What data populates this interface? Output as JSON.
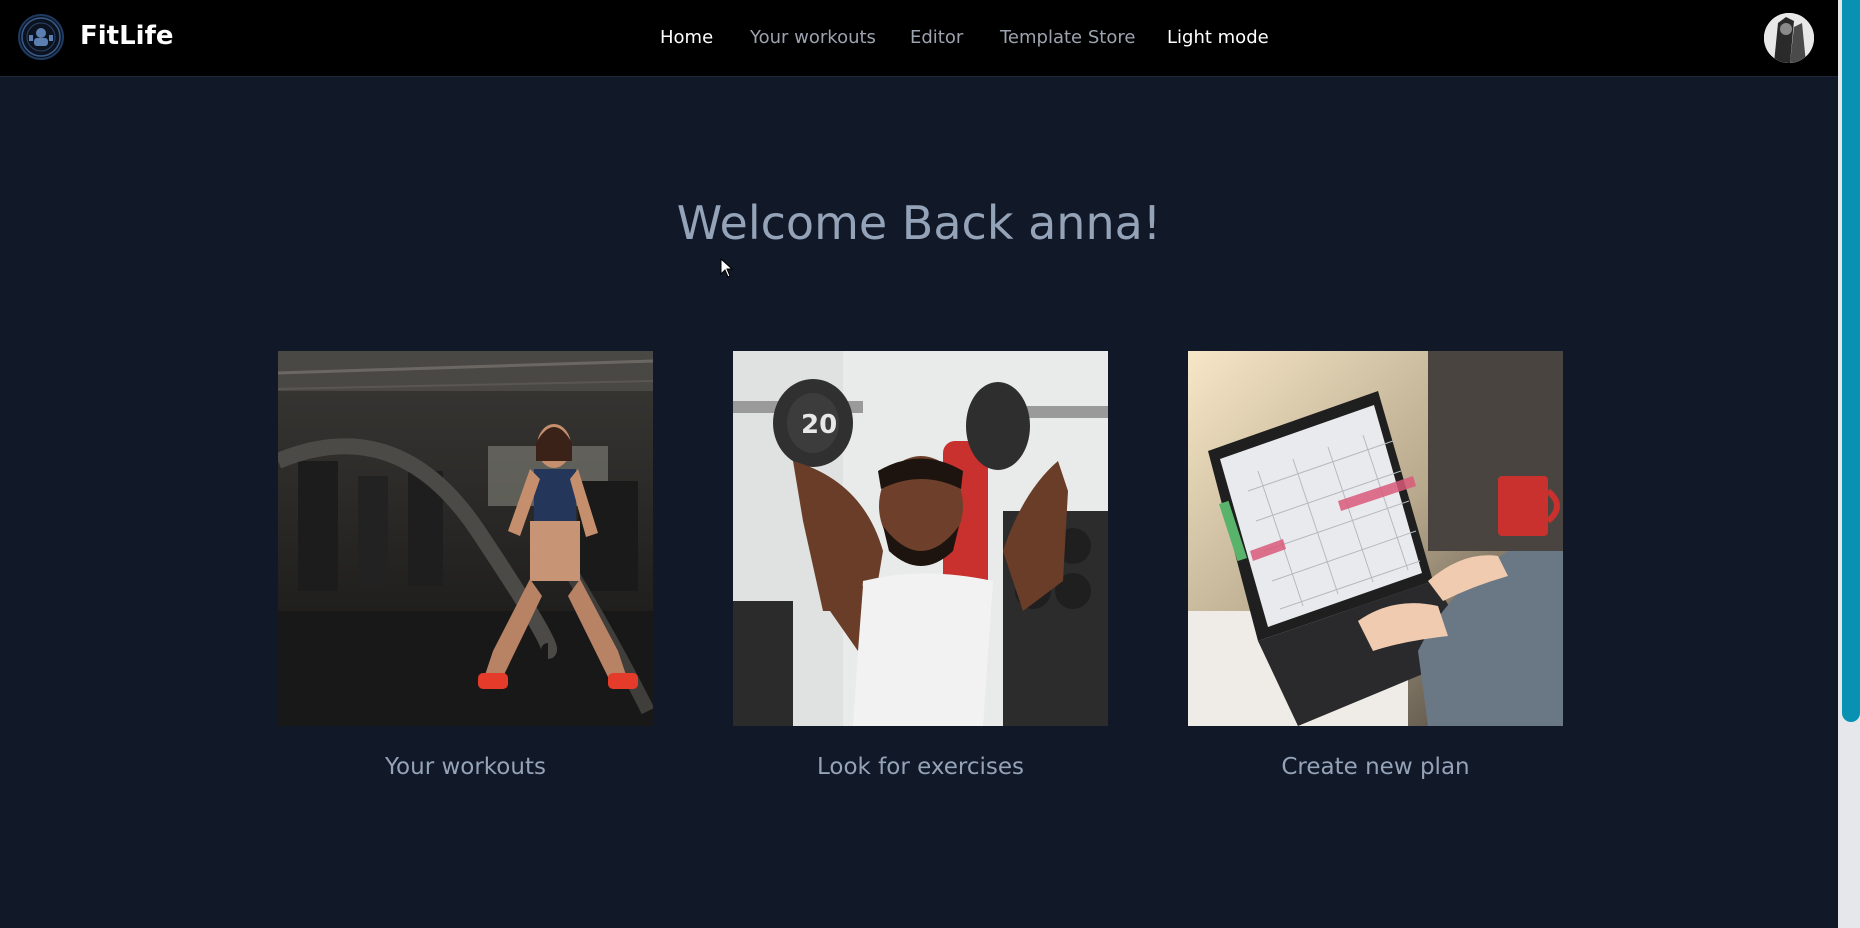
{
  "header": {
    "brand": "FitLife",
    "nav": [
      {
        "label": "Home",
        "active": true
      },
      {
        "label": "Your workouts",
        "active": false
      },
      {
        "label": "Editor",
        "active": false
      },
      {
        "label": "Template Store",
        "active": false
      },
      {
        "label": "Light mode",
        "active": false
      }
    ]
  },
  "main": {
    "welcome": "Welcome Back anna!",
    "cards": [
      {
        "label": "Your workouts",
        "image": "battle-ropes-workout-photo"
      },
      {
        "label": "Look for exercises",
        "image": "dumbbell-press-photo"
      },
      {
        "label": "Create new plan",
        "image": "laptop-calendar-photo"
      }
    ]
  },
  "colors": {
    "background": "#111827",
    "navbar": "#000000",
    "text_muted": "#94a3b8",
    "nav_inactive": "#9ca3af",
    "scrollbar_thumb": "#0891b2"
  }
}
